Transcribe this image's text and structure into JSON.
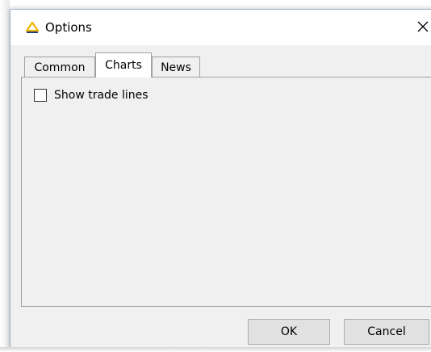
{
  "window": {
    "title": "Options",
    "accent_color": "#f0b400"
  },
  "tabs": [
    {
      "label": "Common",
      "active": false
    },
    {
      "label": "Charts",
      "active": true
    },
    {
      "label": "News",
      "active": false
    }
  ],
  "charts_tab": {
    "show_trade_lines_label": "Show trade lines",
    "show_trade_lines_checked": false
  },
  "buttons": {
    "ok_label": "OK",
    "cancel_label": "Cancel"
  },
  "icons": {
    "app": "triangle-logo-icon",
    "close": "close-icon"
  }
}
